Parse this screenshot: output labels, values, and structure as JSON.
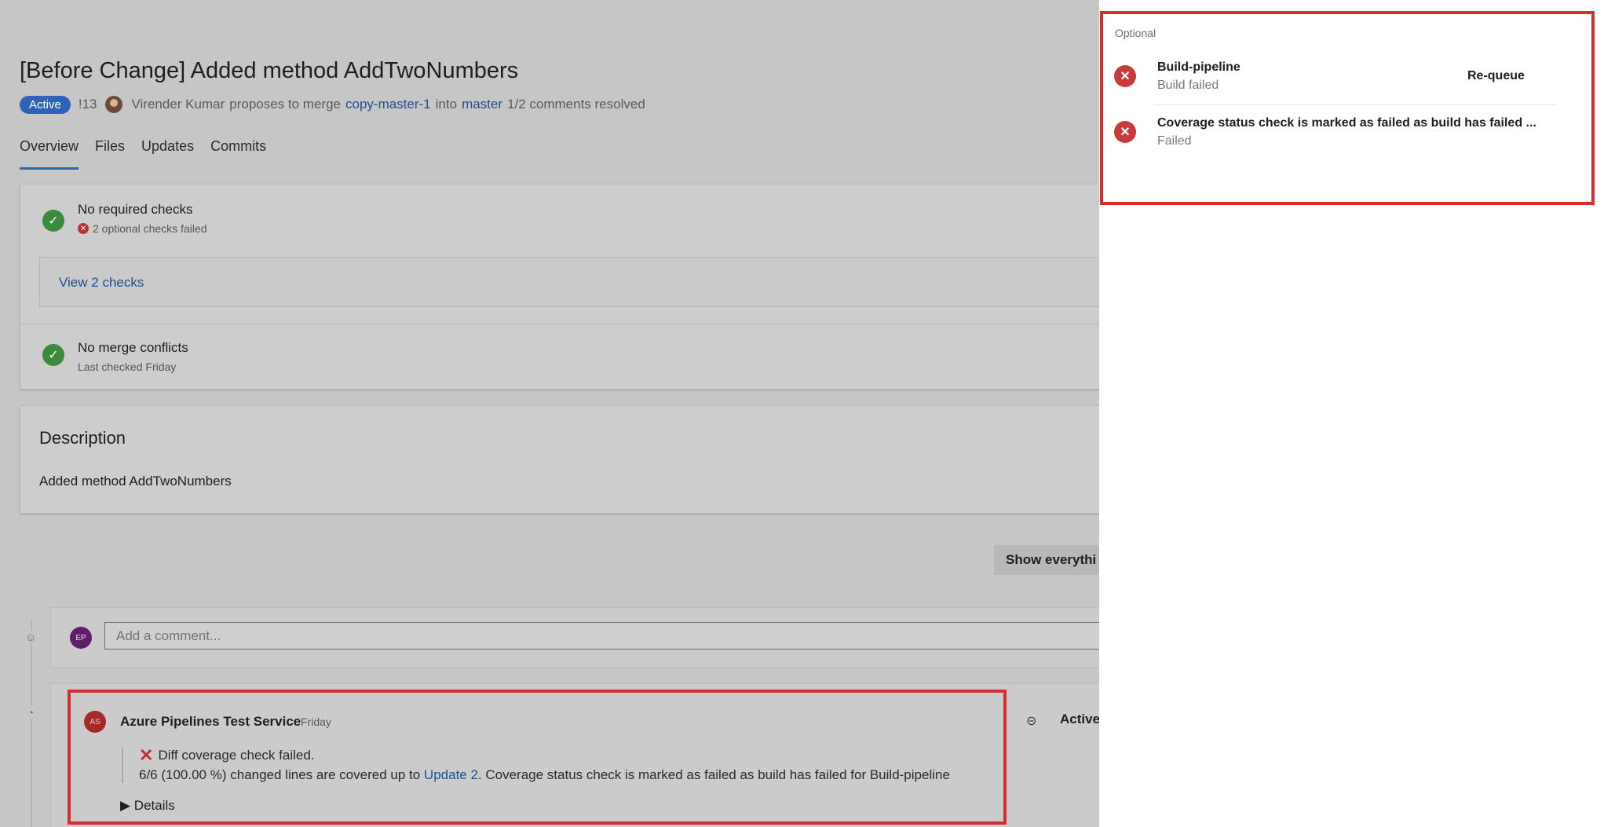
{
  "pr": {
    "title": "[Before Change] Added method AddTwoNumbers",
    "status": "Active",
    "id": "!13",
    "author": "Virender Kumar",
    "proposes_text": "proposes to merge",
    "source_branch": "copy-master-1",
    "into_text": "into",
    "target_branch": "master",
    "comments_resolved": "1/2 comments resolved"
  },
  "tabs": [
    "Overview",
    "Files",
    "Updates",
    "Commits"
  ],
  "checks": {
    "required_title": "No required checks",
    "optional_failed": "2 optional checks failed",
    "view_link": "View 2 checks",
    "merge_title": "No merge conflicts",
    "merge_sub": "Last checked Friday"
  },
  "description": {
    "heading": "Description",
    "body": "Added method AddTwoNumbers"
  },
  "show_button": "Show everythi",
  "comment": {
    "avatar_initials": "EP",
    "placeholder": "Add a comment..."
  },
  "thread": {
    "avatar_initials": "AS",
    "author": "Azure Pipelines Test Service",
    "time": "Friday",
    "line1": "Diff coverage check failed.",
    "line2_prefix": "6/6 (100.00 %) changed lines are covered up to",
    "line2_link": "Update 2",
    "line2_suffix": ". Coverage status check is marked as failed as build has failed for Build-pipeline",
    "details": "Details",
    "status": "Active"
  },
  "panel": {
    "section": "Optional",
    "items": [
      {
        "title": "Build-pipeline",
        "subtitle": "Build failed",
        "action": "Re-queue"
      },
      {
        "title": "Coverage status check is marked as failed as build has failed ...",
        "subtitle": "Failed"
      }
    ]
  },
  "colors": {
    "accent": "#2e64b8",
    "success": "#3c8a3c",
    "error": "#c83b3b",
    "highlight": "#d32f2f"
  }
}
